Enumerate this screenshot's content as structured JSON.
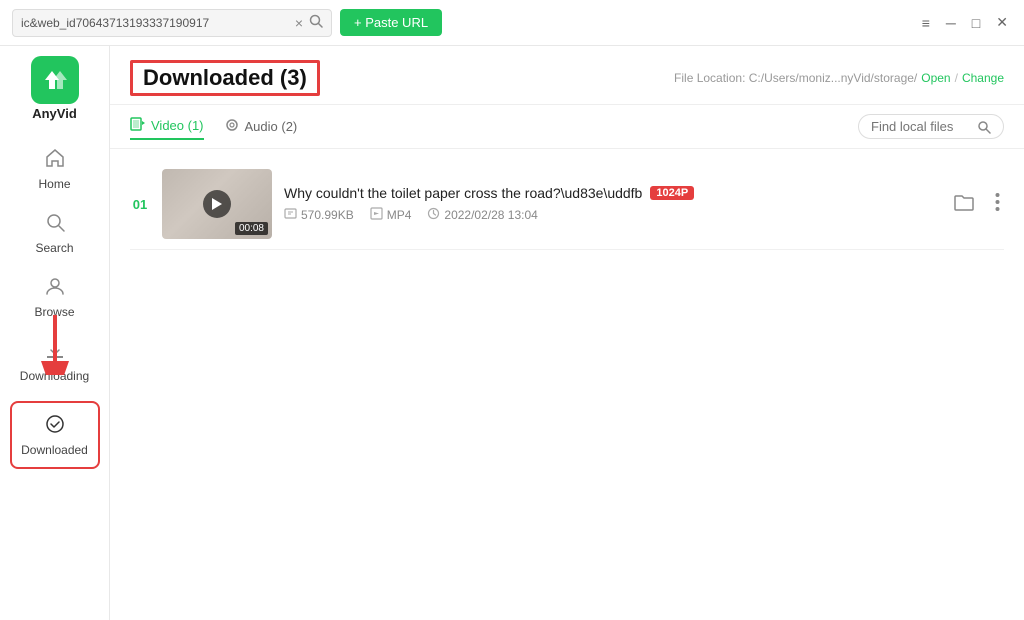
{
  "titlebar": {
    "url": "ic&web_id70643713193337190917",
    "close_char": "×",
    "search_char": "🔍",
    "paste_label": "+ Paste URL",
    "win_menu": "≡",
    "win_min": "─",
    "win_max": "□",
    "win_close": "✕"
  },
  "sidebar": {
    "logo_label": "AnyVid",
    "items": [
      {
        "id": "home",
        "label": "Home",
        "icon": "⌂"
      },
      {
        "id": "search",
        "label": "Search",
        "icon": "🔍"
      },
      {
        "id": "browse",
        "label": "Browse",
        "icon": "👤"
      },
      {
        "id": "downloading",
        "label": "Downloading",
        "icon": "⬇"
      },
      {
        "id": "downloaded",
        "label": "Downloaded",
        "icon": "✓",
        "active": true
      }
    ]
  },
  "content": {
    "title": "Downloaded (3)",
    "file_location_label": "File Location: C:/Users/moniz...nyVid/storage/",
    "open_label": "Open",
    "separator": "/",
    "change_label": "Change",
    "tabs": [
      {
        "id": "video",
        "label": "Video (1)",
        "icon": "▦",
        "active": true
      },
      {
        "id": "audio",
        "label": "Audio (2)",
        "icon": "🎧"
      }
    ],
    "find_local_placeholder": "Find local files",
    "videos": [
      {
        "number": "01",
        "title": "Why couldn't the toilet paper cross the road?\\ud83e\\uddfb",
        "quality": "1024P",
        "size": "570.99KB",
        "format": "MP4",
        "date": "2022/02/28 13:04",
        "duration": "00:08"
      }
    ]
  },
  "colors": {
    "green": "#22c55e",
    "red": "#e53e3e",
    "border_red": "#e53e3e"
  }
}
